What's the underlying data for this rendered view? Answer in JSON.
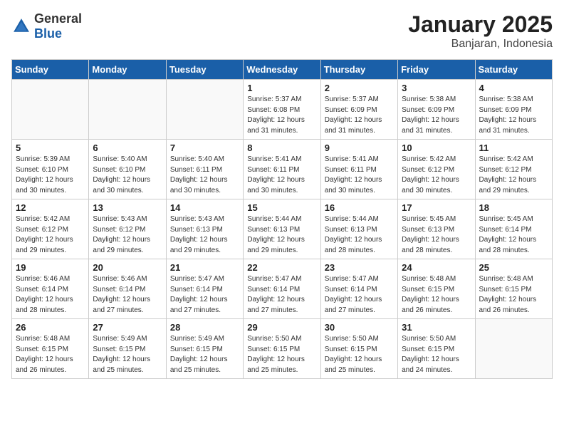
{
  "header": {
    "logo_general": "General",
    "logo_blue": "Blue",
    "title": "January 2025",
    "location": "Banjaran, Indonesia"
  },
  "weekdays": [
    "Sunday",
    "Monday",
    "Tuesday",
    "Wednesday",
    "Thursday",
    "Friday",
    "Saturday"
  ],
  "weeks": [
    [
      {
        "day": "",
        "info": ""
      },
      {
        "day": "",
        "info": ""
      },
      {
        "day": "",
        "info": ""
      },
      {
        "day": "1",
        "info": "Sunrise: 5:37 AM\nSunset: 6:08 PM\nDaylight: 12 hours and 31 minutes."
      },
      {
        "day": "2",
        "info": "Sunrise: 5:37 AM\nSunset: 6:09 PM\nDaylight: 12 hours and 31 minutes."
      },
      {
        "day": "3",
        "info": "Sunrise: 5:38 AM\nSunset: 6:09 PM\nDaylight: 12 hours and 31 minutes."
      },
      {
        "day": "4",
        "info": "Sunrise: 5:38 AM\nSunset: 6:09 PM\nDaylight: 12 hours and 31 minutes."
      }
    ],
    [
      {
        "day": "5",
        "info": "Sunrise: 5:39 AM\nSunset: 6:10 PM\nDaylight: 12 hours and 30 minutes."
      },
      {
        "day": "6",
        "info": "Sunrise: 5:40 AM\nSunset: 6:10 PM\nDaylight: 12 hours and 30 minutes."
      },
      {
        "day": "7",
        "info": "Sunrise: 5:40 AM\nSunset: 6:11 PM\nDaylight: 12 hours and 30 minutes."
      },
      {
        "day": "8",
        "info": "Sunrise: 5:41 AM\nSunset: 6:11 PM\nDaylight: 12 hours and 30 minutes."
      },
      {
        "day": "9",
        "info": "Sunrise: 5:41 AM\nSunset: 6:11 PM\nDaylight: 12 hours and 30 minutes."
      },
      {
        "day": "10",
        "info": "Sunrise: 5:42 AM\nSunset: 6:12 PM\nDaylight: 12 hours and 30 minutes."
      },
      {
        "day": "11",
        "info": "Sunrise: 5:42 AM\nSunset: 6:12 PM\nDaylight: 12 hours and 29 minutes."
      }
    ],
    [
      {
        "day": "12",
        "info": "Sunrise: 5:42 AM\nSunset: 6:12 PM\nDaylight: 12 hours and 29 minutes."
      },
      {
        "day": "13",
        "info": "Sunrise: 5:43 AM\nSunset: 6:12 PM\nDaylight: 12 hours and 29 minutes."
      },
      {
        "day": "14",
        "info": "Sunrise: 5:43 AM\nSunset: 6:13 PM\nDaylight: 12 hours and 29 minutes."
      },
      {
        "day": "15",
        "info": "Sunrise: 5:44 AM\nSunset: 6:13 PM\nDaylight: 12 hours and 29 minutes."
      },
      {
        "day": "16",
        "info": "Sunrise: 5:44 AM\nSunset: 6:13 PM\nDaylight: 12 hours and 28 minutes."
      },
      {
        "day": "17",
        "info": "Sunrise: 5:45 AM\nSunset: 6:13 PM\nDaylight: 12 hours and 28 minutes."
      },
      {
        "day": "18",
        "info": "Sunrise: 5:45 AM\nSunset: 6:14 PM\nDaylight: 12 hours and 28 minutes."
      }
    ],
    [
      {
        "day": "19",
        "info": "Sunrise: 5:46 AM\nSunset: 6:14 PM\nDaylight: 12 hours and 28 minutes."
      },
      {
        "day": "20",
        "info": "Sunrise: 5:46 AM\nSunset: 6:14 PM\nDaylight: 12 hours and 27 minutes."
      },
      {
        "day": "21",
        "info": "Sunrise: 5:47 AM\nSunset: 6:14 PM\nDaylight: 12 hours and 27 minutes."
      },
      {
        "day": "22",
        "info": "Sunrise: 5:47 AM\nSunset: 6:14 PM\nDaylight: 12 hours and 27 minutes."
      },
      {
        "day": "23",
        "info": "Sunrise: 5:47 AM\nSunset: 6:14 PM\nDaylight: 12 hours and 27 minutes."
      },
      {
        "day": "24",
        "info": "Sunrise: 5:48 AM\nSunset: 6:15 PM\nDaylight: 12 hours and 26 minutes."
      },
      {
        "day": "25",
        "info": "Sunrise: 5:48 AM\nSunset: 6:15 PM\nDaylight: 12 hours and 26 minutes."
      }
    ],
    [
      {
        "day": "26",
        "info": "Sunrise: 5:48 AM\nSunset: 6:15 PM\nDaylight: 12 hours and 26 minutes."
      },
      {
        "day": "27",
        "info": "Sunrise: 5:49 AM\nSunset: 6:15 PM\nDaylight: 12 hours and 25 minutes."
      },
      {
        "day": "28",
        "info": "Sunrise: 5:49 AM\nSunset: 6:15 PM\nDaylight: 12 hours and 25 minutes."
      },
      {
        "day": "29",
        "info": "Sunrise: 5:50 AM\nSunset: 6:15 PM\nDaylight: 12 hours and 25 minutes."
      },
      {
        "day": "30",
        "info": "Sunrise: 5:50 AM\nSunset: 6:15 PM\nDaylight: 12 hours and 25 minutes."
      },
      {
        "day": "31",
        "info": "Sunrise: 5:50 AM\nSunset: 6:15 PM\nDaylight: 12 hours and 24 minutes."
      },
      {
        "day": "",
        "info": ""
      }
    ]
  ]
}
